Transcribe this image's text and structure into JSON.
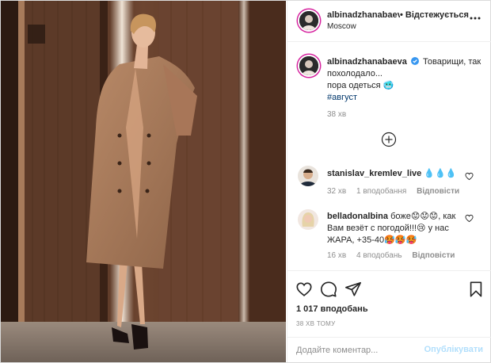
{
  "post": {
    "photo_icon": "photo-woman-trench-coat",
    "header": {
      "username": "albinadzhanabaeva",
      "follow_status": "• Відстежується",
      "location": "Moscow",
      "more_icon": "more-dots-icon"
    },
    "caption": {
      "username": "albinadzhanabaeva",
      "line1": "Товарищи, так",
      "line2": "похолодало...",
      "line3": "пора одеться 🥶",
      "hashtag": "#август",
      "time": "38 хв"
    },
    "load_more_icon": "plus-circle-icon",
    "comments": [
      {
        "username": "stanislav_kremlev_live",
        "text": "💧💧💧",
        "time": "32 хв",
        "likes": "1 вподобання",
        "reply": "Відповісти"
      },
      {
        "username": "belladonalbina",
        "text": "боже😟😟😟, как Вам везёт с погодой!!!😢 у нас ЖАРА, +35-40🥵🥵🥵",
        "time": "16 хв",
        "likes": "4 вподобань",
        "reply": "Відповісти"
      }
    ],
    "actions": {
      "likes_count": "1 017 вподобань",
      "time_ago": "38 ХВ ТОМУ"
    },
    "add_comment": {
      "placeholder": "Додайте коментар...",
      "publish_label": "Опублікувати"
    },
    "colors": {
      "link": "#00376b",
      "publish_disabled": "#b2dffc",
      "verified": "#3897f0",
      "story_ring": "#d6249f"
    }
  }
}
